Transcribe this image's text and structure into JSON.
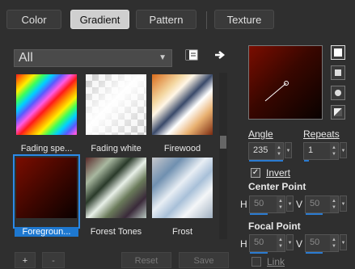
{
  "tabs": [
    {
      "label": "Color"
    },
    {
      "label": "Gradient"
    },
    {
      "label": "Pattern"
    },
    {
      "label": "Texture"
    }
  ],
  "library": {
    "dropdown_value": "All",
    "items": [
      {
        "caption": "Fading spe..."
      },
      {
        "caption": "Fading white"
      },
      {
        "caption": "Firewood"
      },
      {
        "caption": "Foregroun..."
      },
      {
        "caption": "Forest Tones"
      },
      {
        "caption": "Frost"
      }
    ]
  },
  "buttons": {
    "add": "+",
    "remove": "-",
    "reset": "Reset",
    "save": "Save"
  },
  "props": {
    "angle_label": "Angle",
    "angle_value": "235",
    "repeats_label": "Repeats",
    "repeats_value": "1",
    "invert_label": "Invert",
    "center_label": "Center Point",
    "h_label": "H",
    "v_label": "V",
    "center_h": "50",
    "center_v": "50",
    "focal_label": "Focal Point",
    "focal_h": "50",
    "focal_v": "50",
    "link_label": "Link"
  },
  "colors": {
    "accent": "#1e78d0"
  }
}
